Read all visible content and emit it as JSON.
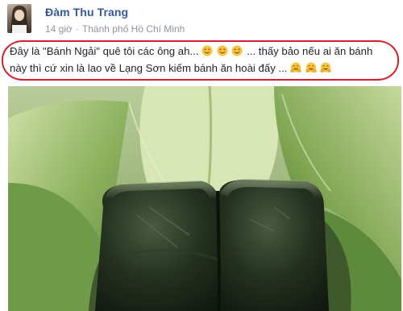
{
  "post": {
    "author": "Đàm Thu Trang",
    "time": "14 giờ",
    "separator": "·",
    "location": "Thành phố Hồ Chí Minh",
    "privacy_icon": "globe-icon",
    "text_line1_a": "Đây là \"Bánh Ngải\" quê tôi các ông ah...",
    "text_line1_b": "... thấy bảo nếu ai ăn bánh",
    "text_line2": "này thì cứ xin là lao về Lạng Sơn kiếm bánh ăn hoài đấy ...",
    "emoji_group1": [
      "smiling-face-emoji",
      "smiling-face-emoji",
      "smiling-face-emoji"
    ],
    "emoji_group2": [
      "hugging-face-emoji",
      "hugging-face-emoji",
      "hugging-face-emoji"
    ]
  },
  "colors": {
    "author_link": "#365899",
    "meta_text": "#90949c",
    "body_text": "#1d2129",
    "highlight": "#d3202a",
    "leaf_green": "#6f9a4a",
    "cake_dark": "#1f2a1e"
  }
}
